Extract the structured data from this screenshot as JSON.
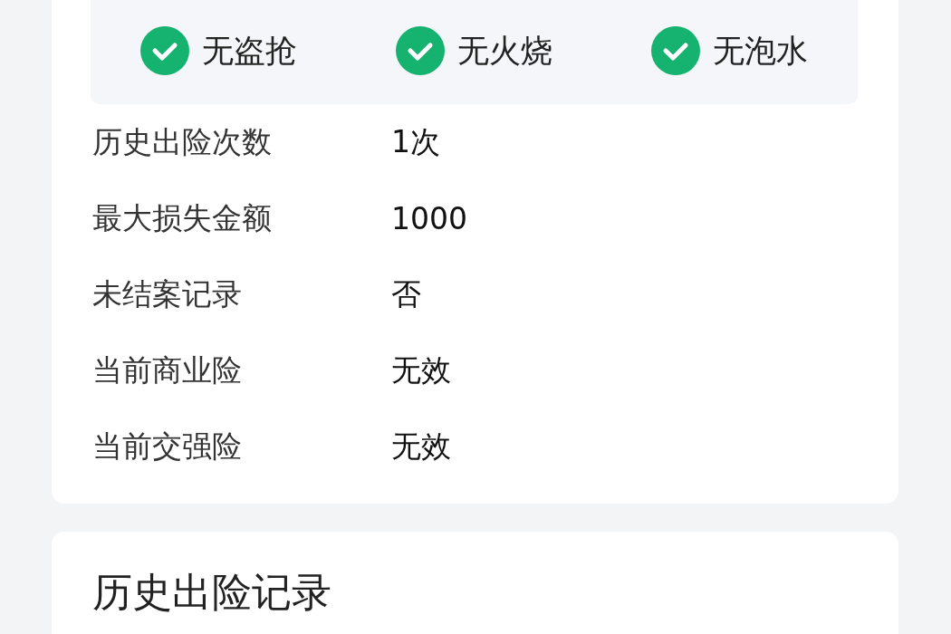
{
  "checks": [
    {
      "label": "无盗抢",
      "checked": true
    },
    {
      "label": "无火烧",
      "checked": true
    },
    {
      "label": "无泡水",
      "checked": true
    }
  ],
  "rows": [
    {
      "label": "历史出险次数",
      "value": "1次"
    },
    {
      "label": "最大损失金额",
      "value": "1000"
    },
    {
      "label": "未结案记录",
      "value": "否"
    },
    {
      "label": "当前商业险",
      "value": "无效"
    },
    {
      "label": "当前交强险",
      "value": "无效"
    }
  ],
  "history": {
    "title": "历史出险记录"
  }
}
